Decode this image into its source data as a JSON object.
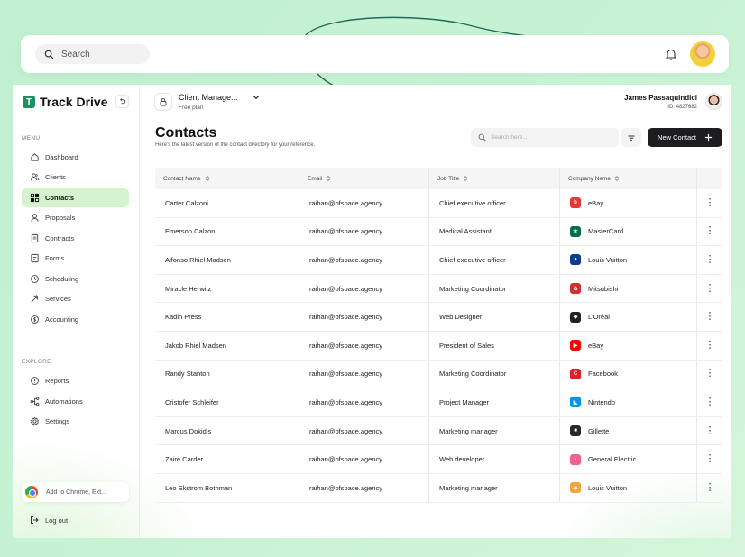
{
  "topbar": {
    "search_placeholder": "Search"
  },
  "app": {
    "name": "Track Drive",
    "logo_letter": "T"
  },
  "sidebar": {
    "menu_label": "MENU",
    "menu_items": [
      {
        "label": "Dashboard",
        "icon": "grid-icon"
      },
      {
        "label": "Clients",
        "icon": "users-icon"
      },
      {
        "label": "Contacts",
        "icon": "contacts-icon",
        "active": true
      },
      {
        "label": "Proposals",
        "icon": "proposal-icon"
      },
      {
        "label": "Contracts",
        "icon": "document-icon"
      },
      {
        "label": "Forms",
        "icon": "form-icon"
      },
      {
        "label": "Scheduling",
        "icon": "clock-icon"
      },
      {
        "label": "Services",
        "icon": "tools-icon"
      },
      {
        "label": "Accounting",
        "icon": "dollar-icon"
      }
    ],
    "explore_label": "EXPLORE",
    "explore_items": [
      {
        "label": "Reports",
        "icon": "report-icon"
      },
      {
        "label": "Automations",
        "icon": "automation-icon"
      },
      {
        "label": "Settings",
        "icon": "gear-icon"
      }
    ],
    "chrome_label": "Add to Chrome, Ext...",
    "logout_label": "Log out"
  },
  "workspace": {
    "name": "Client Manage...",
    "plan": "Free plan"
  },
  "user": {
    "name": "James Passaquindici",
    "id": "ID: 4827682"
  },
  "page": {
    "title": "Contacts",
    "subtitle": "Here's the latest version of the contact directory for your reference.",
    "search_placeholder": "Search here...",
    "new_button": "New Contact"
  },
  "table": {
    "headers": [
      "Contact Name",
      "Email",
      "Job Title",
      "Company Name"
    ],
    "rows": [
      {
        "name": "Carter Calzoni",
        "email": "raihan@ofspace.agency",
        "job": "Chief executive officer",
        "company": "eBay",
        "logo_color": "#e53935",
        "logo_glyph": "b"
      },
      {
        "name": "Emerson Calzoni",
        "email": "raihan@ofspace.agency",
        "job": "Medical Assistant",
        "company": "MasterCard",
        "logo_color": "#00704a",
        "logo_glyph": "★"
      },
      {
        "name": "Alfonso Rhiel Madsen",
        "email": "raihan@ofspace.agency",
        "job": "Chief executive officer",
        "company": "Louis Vuitton",
        "logo_color": "#0b3d91",
        "logo_glyph": "●"
      },
      {
        "name": "Miracle Herwitz",
        "email": "raihan@ofspace.agency",
        "job": "Marketing Coordinator",
        "company": "Mitsubishi",
        "logo_color": "#d32f2f",
        "logo_glyph": "✿"
      },
      {
        "name": "Kadin Press",
        "email": "raihan@ofspace.agency",
        "job": "Web Designer",
        "company": "L'Oréal",
        "logo_color": "#222222",
        "logo_glyph": "◆"
      },
      {
        "name": "Jakob Rhiel Madsen",
        "email": "raihan@ofspace.agency",
        "job": "President of Sales",
        "company": "eBay",
        "logo_color": "#ff0000",
        "logo_glyph": "▶"
      },
      {
        "name": "Randy Stanton",
        "email": "raihan@ofspace.agency",
        "job": "Marketing Coordinator",
        "company": "Facebook",
        "logo_color": "#e41e26",
        "logo_glyph": "C"
      },
      {
        "name": "Cristofer Schleifer",
        "email": "raihan@ofspace.agency",
        "job": "Project Manager",
        "company": "Nintendo",
        "logo_color": "#0095e8",
        "logo_glyph": "◣"
      },
      {
        "name": "Marcus Dokidis",
        "email": "raihan@ofspace.agency",
        "job": "Marketing manager",
        "company": "Gillette",
        "logo_color": "#24292e",
        "logo_glyph": "■"
      },
      {
        "name": "Zaire Carder",
        "email": "raihan@ofspace.agency",
        "job": "Web developer",
        "company": "General Electric",
        "logo_color": "#f06292",
        "logo_glyph": "▪"
      },
      {
        "name": "Leo Ekstrom Bothman",
        "email": "raihan@ofspace.agency",
        "job": "Marketing manager",
        "company": "Louis Vuitton",
        "logo_color": "#f2a33a",
        "logo_glyph": "◆"
      }
    ]
  },
  "colors": {
    "accent": "#1f8f5f",
    "active_nav": "#d6f3cf",
    "primary_button": "#1d1d1f"
  }
}
